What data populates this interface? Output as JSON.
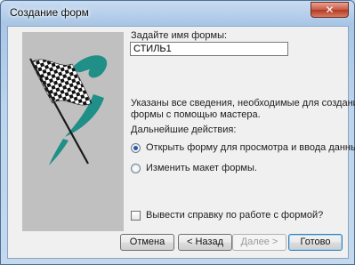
{
  "window": {
    "title": "Создание форм",
    "close_label": "✕"
  },
  "form": {
    "name_label": "Задайте имя формы:",
    "name_value": "СТИЛЬ1",
    "info_text_line1": "Указаны все сведения, необходимые для создания",
    "info_text_line2": "формы с помощью мастера.",
    "next_actions_label": "Дальнейшие действия:",
    "options": [
      {
        "label": "Открыть форму для просмотра и ввода данных.",
        "selected": true
      },
      {
        "label": "Изменить макет формы.",
        "selected": false
      }
    ],
    "help_checkbox_label": "Вывести справку по работе с формой?",
    "help_checked": false
  },
  "buttons": {
    "cancel": "Отмена",
    "back": "< Назад",
    "next": "Далее >",
    "finish": "Готово"
  },
  "colors": {
    "flag_teal": "#1f8f87",
    "art_background": "#c0c0c0",
    "title_gradient_top": "#c8dcf1"
  },
  "icons": {
    "illustration": "checkered-flag-illustration",
    "close": "close-icon"
  }
}
